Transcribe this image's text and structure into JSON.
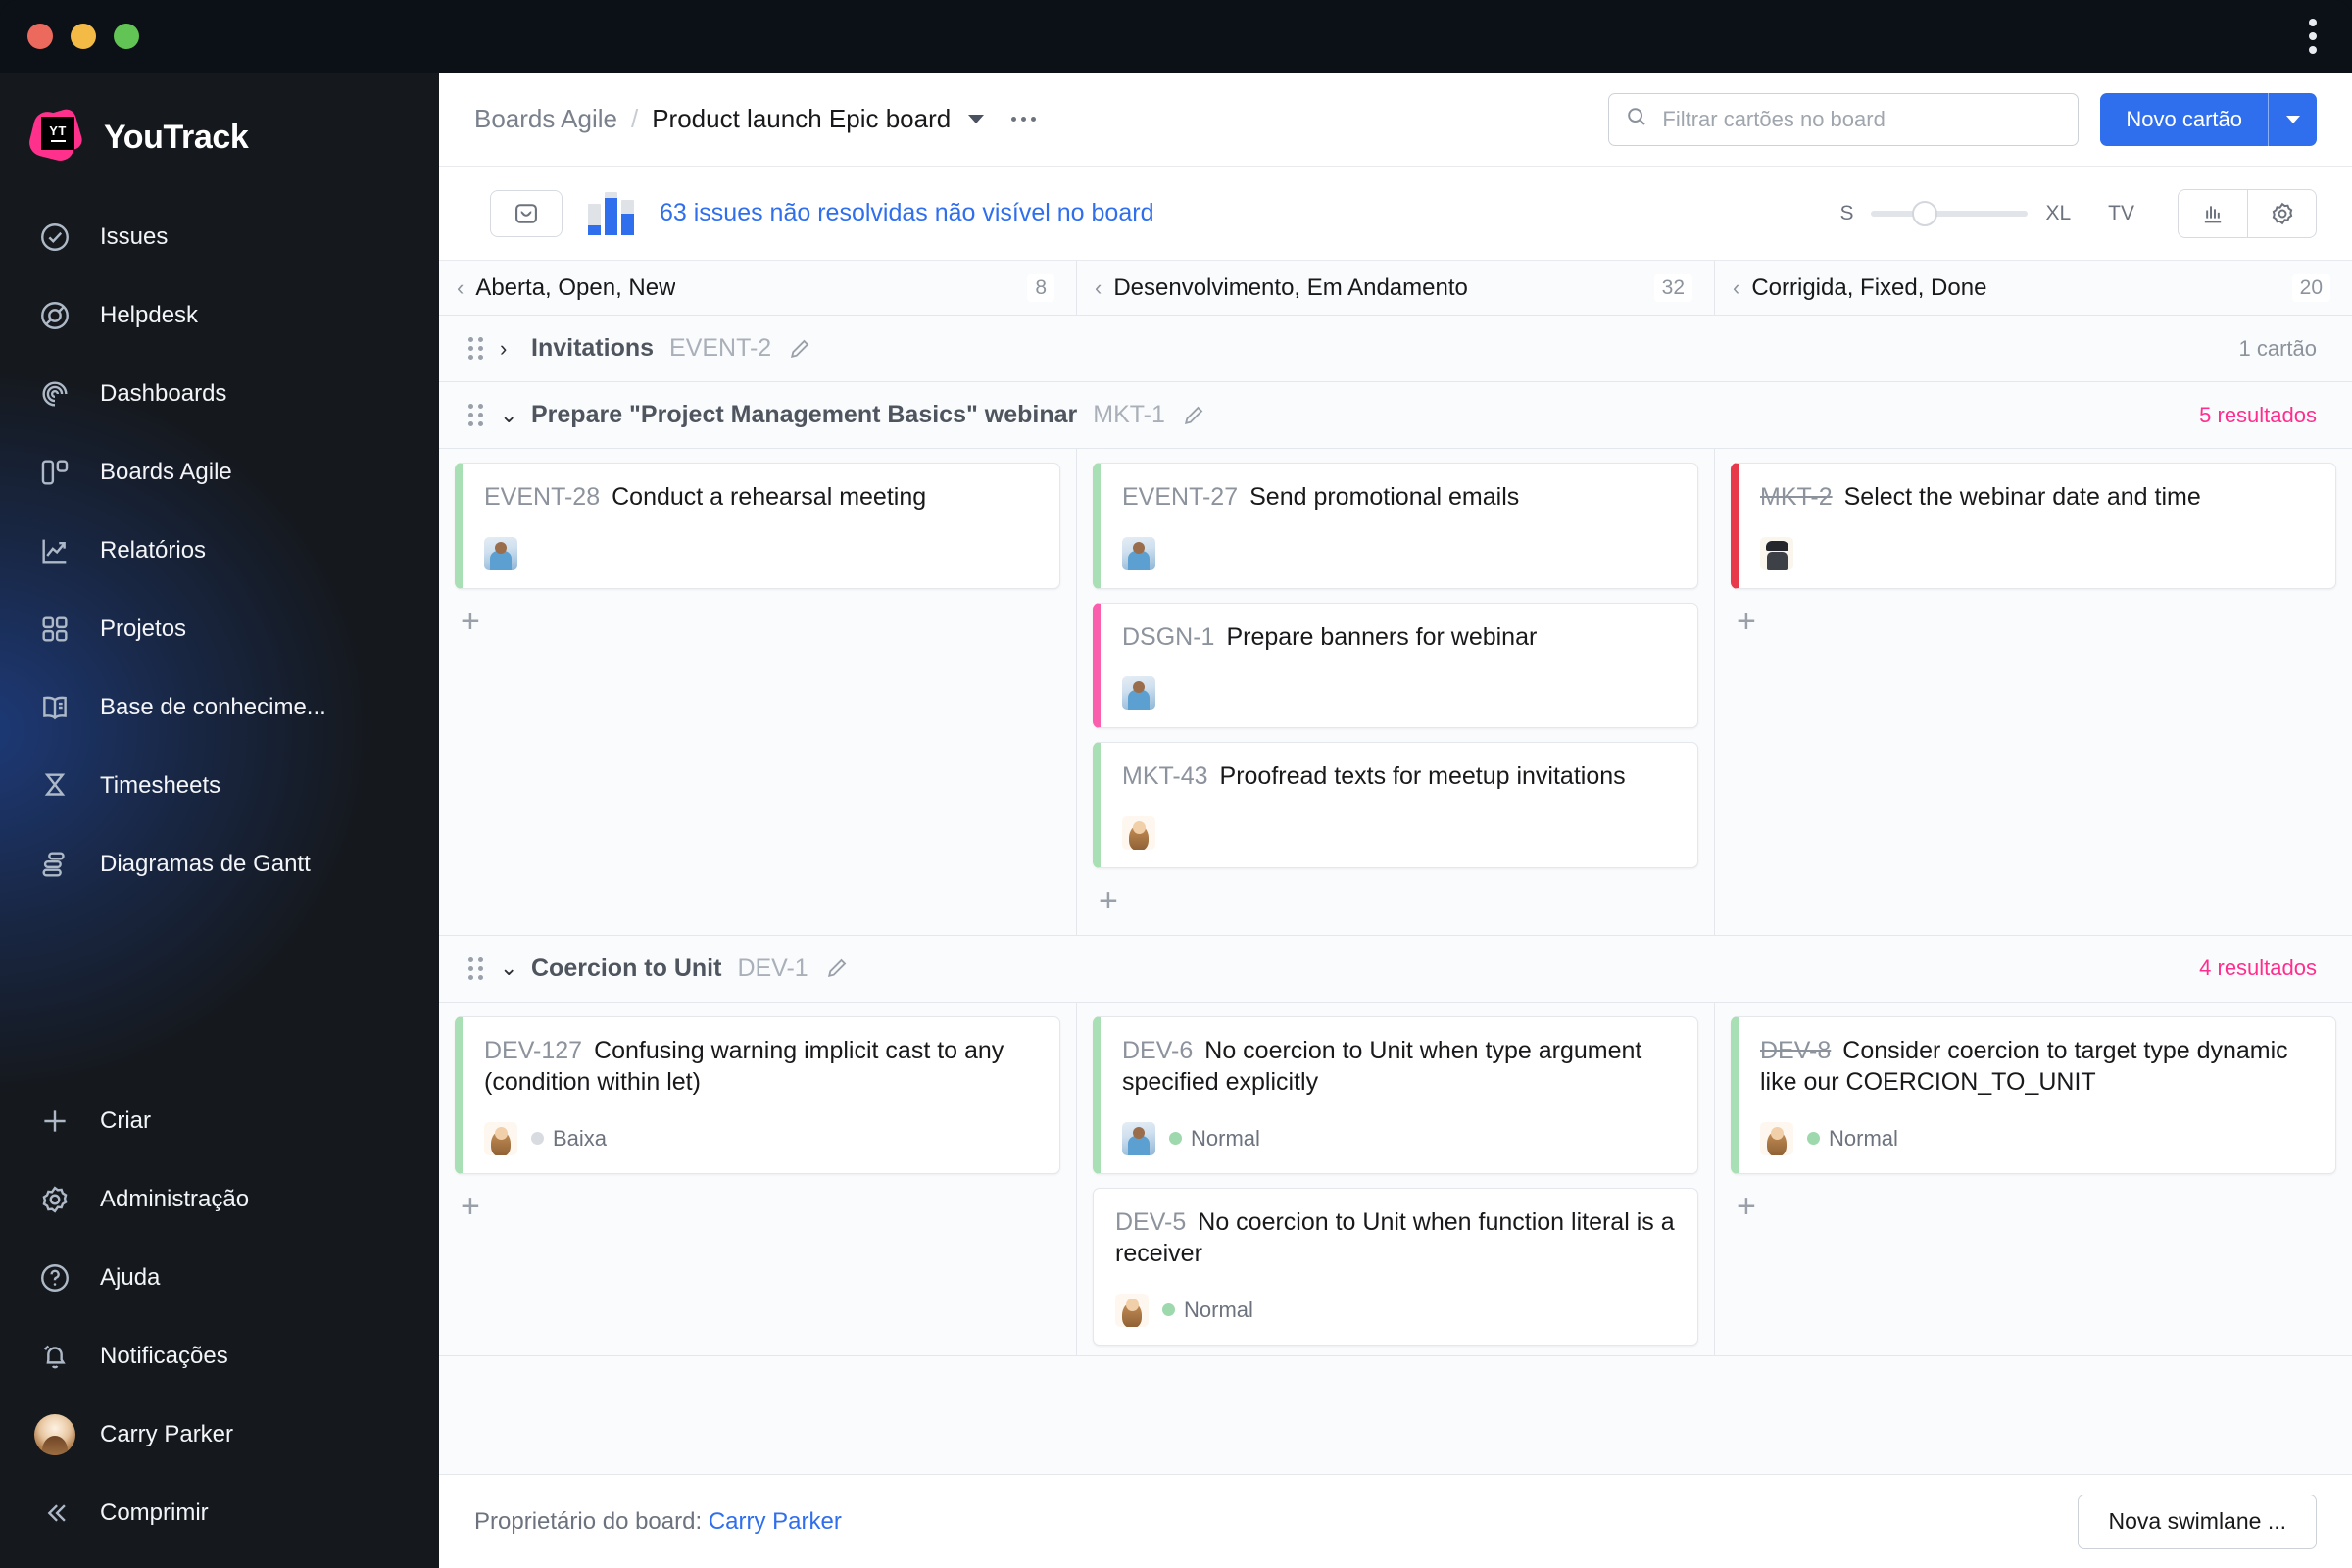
{
  "window": {
    "traffic_lights": [
      "close",
      "minimize",
      "maximize"
    ],
    "menu_icon": "kebab-menu-icon"
  },
  "sidebar": {
    "brand": "YouTrack",
    "logo_text": "YT",
    "items": [
      {
        "label": "Issues",
        "icon": "check-circle-icon"
      },
      {
        "label": "Helpdesk",
        "icon": "lifebuoy-icon"
      },
      {
        "label": "Dashboards",
        "icon": "spiral-icon"
      },
      {
        "label": "Boards Agile",
        "icon": "board-icon"
      },
      {
        "label": "Relatórios",
        "icon": "chart-trend-icon"
      },
      {
        "label": "Projetos",
        "icon": "grid-squares-icon"
      },
      {
        "label": "Base de conhecime...",
        "icon": "book-icon"
      },
      {
        "label": "Timesheets",
        "icon": "hourglass-icon"
      },
      {
        "label": "Diagramas de Gantt",
        "icon": "gantt-icon"
      }
    ],
    "bottom_items": [
      {
        "label": "Criar",
        "icon": "plus-icon"
      },
      {
        "label": "Administração",
        "icon": "gear-icon"
      },
      {
        "label": "Ajuda",
        "icon": "question-circle-icon"
      },
      {
        "label": "Notificações",
        "icon": "bell-icon"
      }
    ],
    "user": {
      "name": "Carry Parker",
      "icon": "avatar"
    },
    "collapse": {
      "label": "Comprimir",
      "icon": "double-chevron-left-icon"
    }
  },
  "header": {
    "breadcrumb_root": "Boards Agile",
    "breadcrumb_separator": "/",
    "breadcrumb_current": "Product launch Epic board",
    "board_menu_icon": "chevron-down-icon",
    "more_icon": "ellipsis-icon",
    "search": {
      "placeholder": "Filtrar cartões no board",
      "value": "",
      "icon": "search-icon"
    },
    "new_card_label": "Novo cartão",
    "new_card_caret_icon": "chevron-down-icon"
  },
  "toolbar": {
    "inbox_icon": "inbox-icon",
    "chart_icon": "bar-chart-icon",
    "issues_message": "63 issues não resolvidas não visível no board",
    "size_min": "S",
    "size_max": "XL",
    "tv_label": "TV",
    "slider_position_pct": 34,
    "view_chart_icon": "chart-columns-icon",
    "settings_icon": "gear-icon"
  },
  "columns": [
    {
      "name": "Aberta, Open, New",
      "count": "8"
    },
    {
      "name": "Desenvolvimento, Em Andamento",
      "count": "32"
    },
    {
      "name": "Corrigida, Fixed, Done",
      "count": "20"
    }
  ],
  "swimlanes": [
    {
      "title": "Invitations",
      "id": "EVENT-2",
      "collapsed": true,
      "toggle_icon": "chevron-right-icon",
      "edit_icon": "pencil-icon",
      "count_label": "1 cartão",
      "count_highlight": false,
      "cells": []
    },
    {
      "title": "Prepare \"Project Management Basics\" webinar",
      "id": "MKT-1",
      "collapsed": false,
      "toggle_icon": "chevron-down-icon",
      "edit_icon": "pencil-icon",
      "count_label": "5 resultados",
      "count_highlight": true,
      "cells": [
        {
          "add_label": "+",
          "cards": [
            {
              "id": "EVENT-28",
              "title": "Conduct a rehearsal meeting",
              "resolved": false,
              "accent": "green",
              "avatar": "blue",
              "priority": null
            }
          ]
        },
        {
          "add_label": "+",
          "cards": [
            {
              "id": "EVENT-27",
              "title": "Send promotional emails",
              "resolved": false,
              "accent": "green",
              "avatar": "blue",
              "priority": null
            },
            {
              "id": "DSGN-1",
              "title": "Prepare banners for webinar",
              "resolved": false,
              "accent": "pink",
              "avatar": "blue",
              "priority": null
            },
            {
              "id": "MKT-43",
              "title": "Proofread texts for meetup invitations",
              "resolved": false,
              "accent": "green",
              "avatar": "girl",
              "priority": null
            }
          ]
        },
        {
          "add_label": "+",
          "cards": [
            {
              "id": "MKT-2",
              "title": "Select the webinar date and time",
              "resolved": true,
              "accent": "red",
              "avatar": "hat",
              "priority": null
            }
          ]
        }
      ]
    },
    {
      "title": "Coercion to Unit",
      "id": "DEV-1",
      "collapsed": false,
      "toggle_icon": "chevron-down-icon",
      "edit_icon": "pencil-icon",
      "count_label": "4 resultados",
      "count_highlight": true,
      "cells": [
        {
          "add_label": "+",
          "cards": [
            {
              "id": "DEV-127",
              "title": "Confusing warning implicit cast to any (condition within let)",
              "resolved": false,
              "accent": "green",
              "avatar": "girl",
              "priority": {
                "label": "Baixa",
                "color": "#d8dce1"
              }
            }
          ]
        },
        {
          "add_label": "",
          "cards": [
            {
              "id": "DEV-6",
              "title": "No coercion to Unit when type argument specified explicitly",
              "resolved": false,
              "accent": "green",
              "avatar": "blue",
              "priority": {
                "label": "Normal",
                "color": "#9ed8ad"
              }
            },
            {
              "id": "DEV-5",
              "title": "No coercion to Unit when function literal is a receiver",
              "resolved": false,
              "accent": "none",
              "avatar": "girl",
              "priority": {
                "label": "Normal",
                "color": "#9ed8ad"
              }
            }
          ]
        },
        {
          "add_label": "+",
          "cards": [
            {
              "id": "DEV-8",
              "title": "Consider coercion to target type dynamic like our COERCION_TO_UNIT",
              "resolved": true,
              "accent": "green",
              "avatar": "girl",
              "priority": {
                "label": "Normal",
                "color": "#9ed8ad"
              }
            }
          ]
        }
      ]
    }
  ],
  "footer": {
    "owner_label": "Proprietário do board:",
    "owner_name": "Carry Parker",
    "new_swimlane_label": "Nova swimlane ..."
  },
  "colors": {
    "accent_blue": "#2f6fee",
    "accent_pink": "#ff2e8e",
    "card_green": "#a9dfb4",
    "card_pink": "#fa5fae",
    "card_red": "#e8394a"
  }
}
